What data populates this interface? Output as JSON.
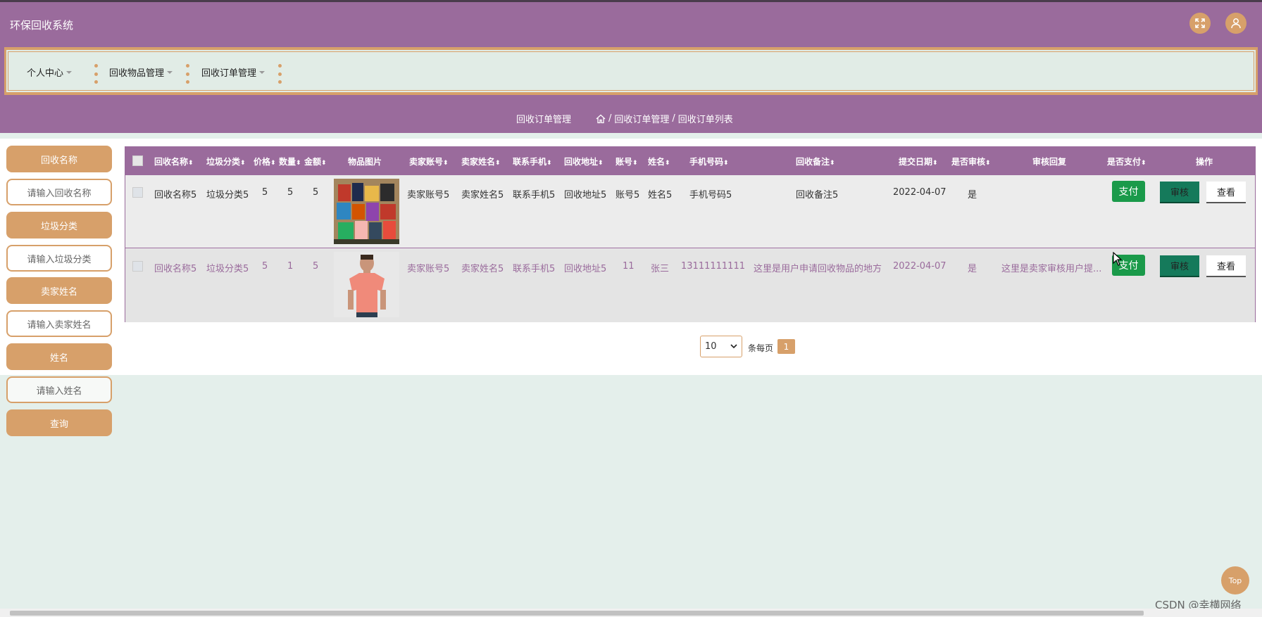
{
  "app": {
    "title": "环保回收系统"
  },
  "header": {
    "fullscreen_icon": "expand-icon",
    "user_icon": "user-icon"
  },
  "menu": {
    "items": [
      {
        "label": "个人中心"
      },
      {
        "label": "回收物品管理"
      },
      {
        "label": "回收订单管理"
      }
    ]
  },
  "breadcrumb": {
    "title": "回收订单管理",
    "path": [
      "回收订单管理",
      "回收订单列表"
    ],
    "sep": "/"
  },
  "sidebar": {
    "fields": [
      {
        "label": "回收名称",
        "placeholder": "请输入回收名称"
      },
      {
        "label": "垃圾分类",
        "placeholder": "请输入垃圾分类"
      },
      {
        "label": "卖家姓名",
        "placeholder": "请输入卖家姓名"
      },
      {
        "label": "姓名",
        "placeholder": "请输入姓名"
      }
    ],
    "search_label": "查询"
  },
  "table": {
    "columns": [
      "回收名称",
      "垃圾分类",
      "价格",
      "数量",
      "金额",
      "物品图片",
      "卖家账号",
      "卖家姓名",
      "联系手机",
      "回收地址",
      "账号",
      "姓名",
      "手机号码",
      "回收备注",
      "提交日期",
      "是否审核",
      "审核回复",
      "是否支付",
      "操作"
    ],
    "rows": [
      {
        "name": "回收名称5",
        "category": "垃圾分类5",
        "price": "5",
        "qty": "5",
        "amount": "5",
        "image": "colorful-packages",
        "seller_account": "卖家账号5",
        "seller_name": "卖家姓名5",
        "phone": "联系手机5",
        "address": "回收地址5",
        "account": "账号5",
        "username": "姓名5",
        "mobile": "手机号码5",
        "remark": "回收备注5",
        "date": "2022-04-07",
        "audited": "是",
        "reply": "",
        "pay_label": "支付",
        "audit_label": "审核",
        "view_label": "查看"
      },
      {
        "name": "回收名称5",
        "category": "垃圾分类5",
        "price": "5",
        "qty": "1",
        "amount": "5",
        "image": "pink-tshirt",
        "seller_account": "卖家账号5",
        "seller_name": "卖家姓名5",
        "phone": "联系手机5",
        "address": "回收地址5",
        "account": "11",
        "username": "张三",
        "mobile": "13111111111",
        "remark": "这里是用户申请回收物品的地方",
        "date": "2022-04-07",
        "audited": "是",
        "reply": "这里是卖家审核用户提...",
        "pay_label": "支付",
        "audit_label": "审核",
        "view_label": "查看"
      }
    ]
  },
  "pagination": {
    "page_size": "10",
    "per_page_label": "条每页",
    "current_page": "1"
  },
  "footer": {
    "top_label": "Top",
    "watermark": "CSDN @幸横网络"
  },
  "colors": {
    "primary": "#9a6b9c",
    "accent": "#d7a06a",
    "pay": "#1a9a4a",
    "audit": "#157a5b",
    "background": "#e4efeb"
  }
}
